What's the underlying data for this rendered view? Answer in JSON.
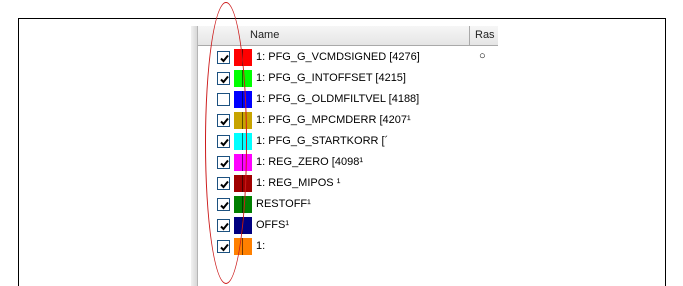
{
  "header": {
    "name": "Name",
    "ras": "Ras"
  },
  "signals": [
    {
      "checked": true,
      "color": "#ff0000",
      "label": "1: PFG_G_VCMDSIGNED [4276]",
      "ras": "○"
    },
    {
      "checked": true,
      "color": "#00ff00",
      "label": "1: PFG_G_INTOFFSET [4215]"
    },
    {
      "checked": false,
      "color": "#0000ff",
      "label": "1: PFG_G_OLDMFILTVEL [4188]"
    },
    {
      "checked": true,
      "color": "#c8a400",
      "label": "1: PFG_G_MPCMDERR [4207¹"
    },
    {
      "checked": true,
      "color": "#00ffff",
      "label": "1: PFG_G_STARTKORR [´"
    },
    {
      "checked": true,
      "color": "#ff00ff",
      "label": "1: REG_ZERO [4098¹"
    },
    {
      "checked": true,
      "color": "#a00000",
      "label": "1: REG_MIPOS ¹"
    },
    {
      "checked": true,
      "color": "#007f00",
      "label": "RESTOFF¹"
    },
    {
      "checked": true,
      "color": "#000080",
      "label": "OFFS¹"
    },
    {
      "checked": true,
      "color": "#ff8000",
      "label": "1: "
    }
  ],
  "colors": {
    "highlight_ellipse": "#cc1a1a",
    "checkbox_border": "#1c5180"
  }
}
